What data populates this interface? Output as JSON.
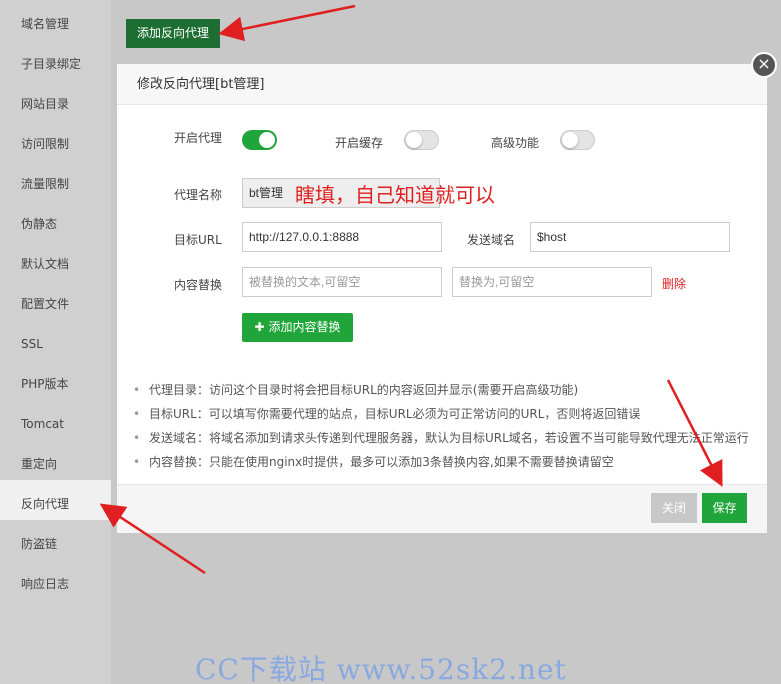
{
  "sidebar": {
    "items": [
      {
        "label": "域名管理"
      },
      {
        "label": "子目录绑定"
      },
      {
        "label": "网站目录"
      },
      {
        "label": "访问限制"
      },
      {
        "label": "流量限制"
      },
      {
        "label": "伪静态"
      },
      {
        "label": "默认文档"
      },
      {
        "label": "配置文件"
      },
      {
        "label": "SSL"
      },
      {
        "label": "PHP版本"
      },
      {
        "label": "Tomcat"
      },
      {
        "label": "重定向"
      },
      {
        "label": "反向代理"
      },
      {
        "label": "防盗链"
      },
      {
        "label": "响应日志"
      }
    ],
    "active_index": 12
  },
  "toolbar": {
    "add_proxy_label": "添加反向代理"
  },
  "dialog": {
    "title": "修改反向代理[bt管理]",
    "enable_proxy_label": "开启代理",
    "enable_proxy_on": true,
    "enable_cache_label": "开启缓存",
    "enable_cache_on": false,
    "advanced_label": "高级功能",
    "advanced_on": false,
    "proxy_name_label": "代理名称",
    "proxy_name_value": "bt管理",
    "annotation": "瞎填，自己知道就可以",
    "target_url_label": "目标URL",
    "target_url_value": "http://127.0.0.1:8888",
    "send_domain_label": "发送域名",
    "send_domain_value": "$host",
    "replace_label": "内容替换",
    "replace_from_placeholder": "被替换的文本,可留空",
    "replace_to_placeholder": "替换为,可留空",
    "delete_label": "删除",
    "add_replace_label": "添加内容替换",
    "tips": [
      "代理目录：访问这个目录时将会把目标URL的内容返回并显示(需要开启高级功能)",
      "目标URL：可以填写你需要代理的站点，目标URL必须为可正常访问的URL，否则将返回错误",
      "发送域名：将域名添加到请求头传递到代理服务器，默认为目标URL域名，若设置不当可能导致代理无法正常运行",
      "内容替换：只能在使用nginx时提供，最多可以添加3条替换内容,如果不需要替换请留空"
    ],
    "close_label": "关闭",
    "save_label": "保存"
  },
  "watermark": "CC下载站 www.52sk2.net",
  "colors": {
    "accent": "#20a53a",
    "danger": "#e02020",
    "dark_green": "#1e6e33"
  }
}
